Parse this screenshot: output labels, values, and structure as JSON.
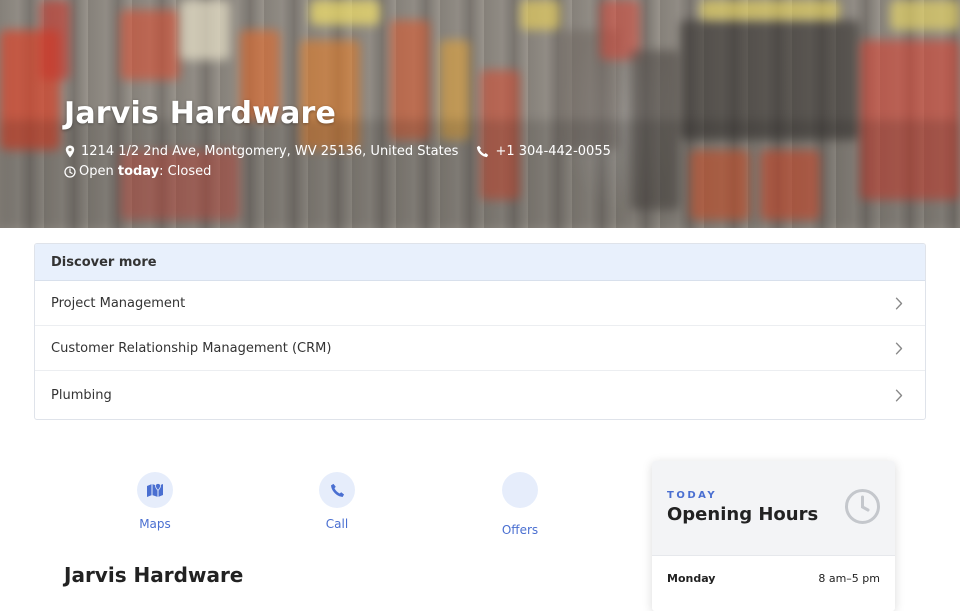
{
  "hero": {
    "title": "Jarvis Hardware",
    "address": "1214 1/2 2nd Ave, Montgomery, WV 25136, United States",
    "phone": "+1 304-442-0055",
    "status_prefix": "Open ",
    "status_bold": "today",
    "status_suffix": ": Closed"
  },
  "discover": {
    "heading": "Discover more",
    "items": [
      {
        "label": "Project Management"
      },
      {
        "label": "Customer Relationship Management (CRM)"
      },
      {
        "label": "Plumbing"
      }
    ]
  },
  "actions": {
    "maps": "Maps",
    "call": "Call",
    "offers": "Offers"
  },
  "business": {
    "name": "Jarvis Hardware"
  },
  "hours": {
    "kicker": "TODAY",
    "title": "Opening Hours",
    "rows": [
      {
        "day": "Monday",
        "time": "8 am–5 pm"
      }
    ]
  },
  "colors": {
    "accent": "#4a6fd1",
    "discover_header_bg": "#e8f0fc",
    "action_circle_bg": "#e6edfb"
  }
}
